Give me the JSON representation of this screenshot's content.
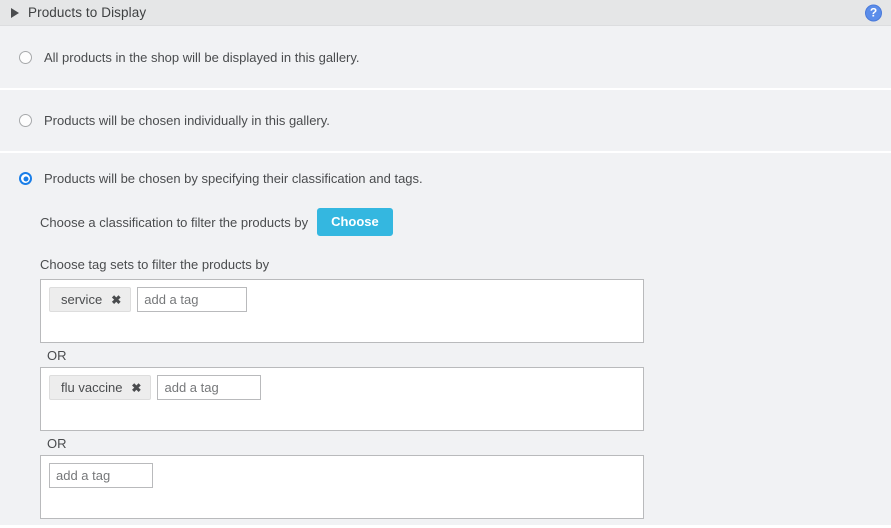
{
  "header": {
    "title": "Products to Display",
    "disclosure_icon": "triangle-right-icon",
    "help_icon": "help-circle-icon",
    "help_glyph": "?"
  },
  "options": [
    {
      "id": "all-products",
      "label": "All products in the shop will be displayed in this gallery.",
      "selected": false
    },
    {
      "id": "individual-products",
      "label": "Products will be chosen individually in this gallery.",
      "selected": false
    },
    {
      "id": "classification-tags",
      "label": "Products will be chosen by specifying their classification and tags.",
      "selected": true
    }
  ],
  "classification": {
    "label": "Choose a classification to filter the products by",
    "button_label": "Choose"
  },
  "tagsets": {
    "label": "Choose tag sets to filter the products by",
    "or_label": "OR",
    "input_placeholder": "add a tag",
    "remove_glyph": "✖",
    "sets": [
      {
        "tags": [
          "service"
        ]
      },
      {
        "tags": [
          "flu vaccine"
        ]
      },
      {
        "tags": []
      }
    ]
  },
  "colors": {
    "accent_button": "#34b7e0",
    "radio_selected": "#1a7ee8",
    "help_icon": "#5b8dea",
    "row_background": "#f1f2f4",
    "header_background": "#e5e6e7"
  }
}
